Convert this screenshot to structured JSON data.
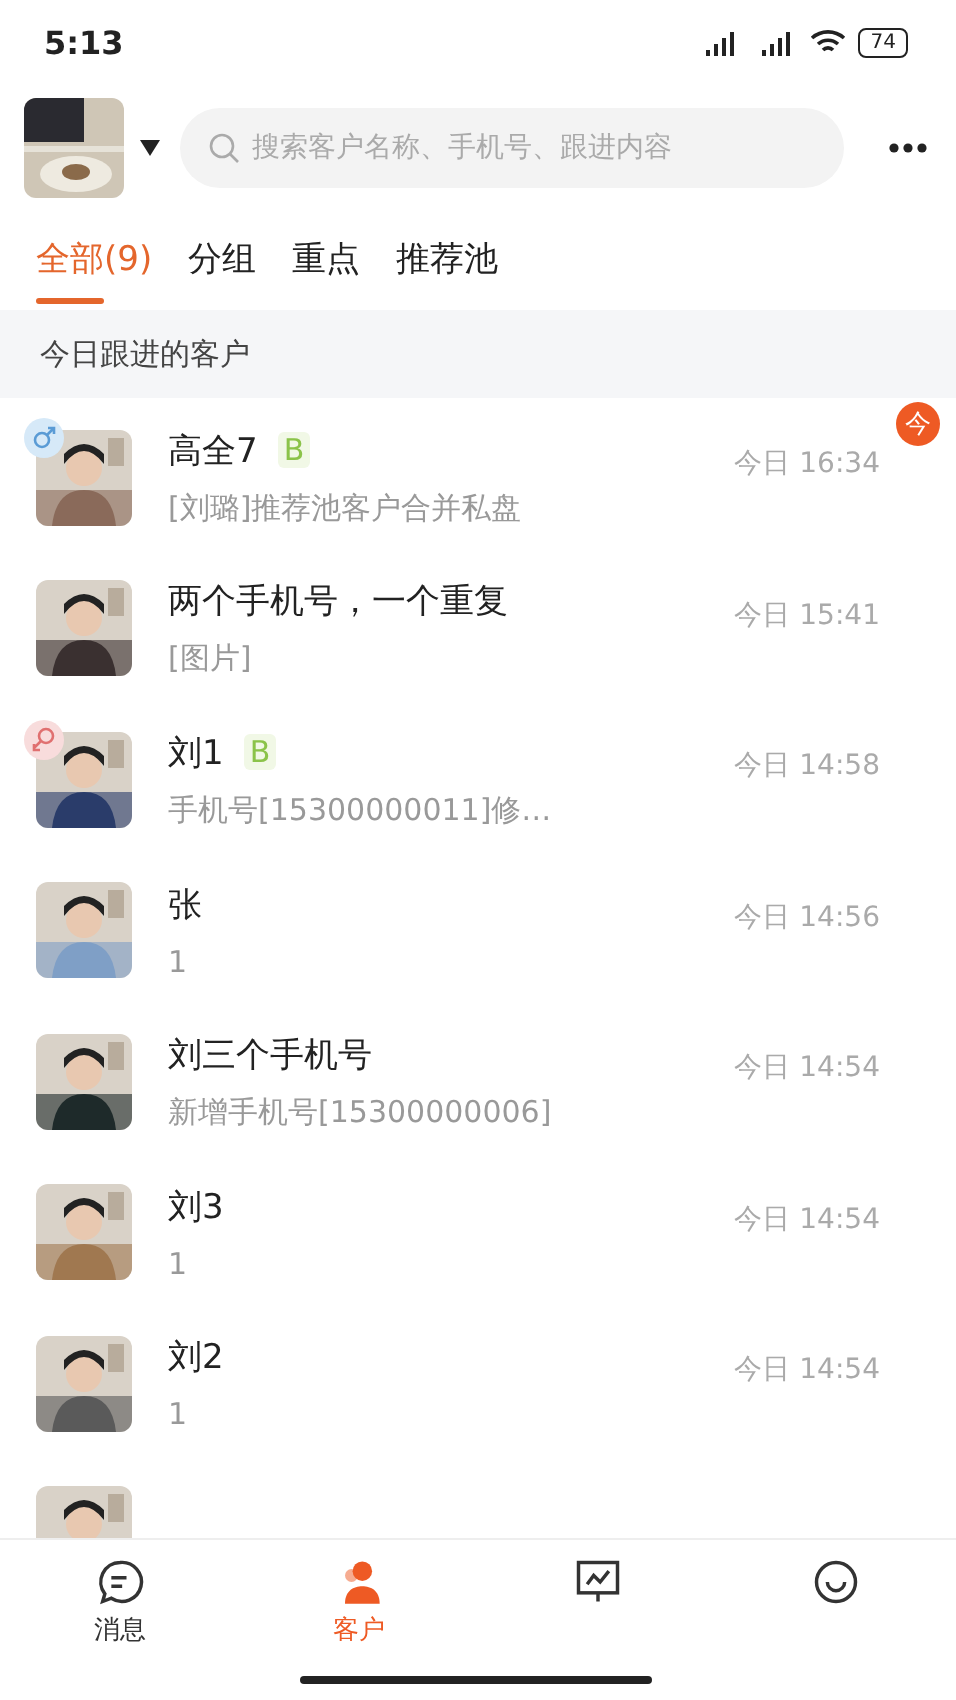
{
  "status_bar": {
    "time": "5:13",
    "battery": "74"
  },
  "header": {
    "search": {
      "placeholder": "搜索客户名称、手机号、跟进内容"
    }
  },
  "tabs": [
    {
      "label": "全部(9)",
      "selected": true
    },
    {
      "label": "分组",
      "selected": false
    },
    {
      "label": "重点",
      "selected": false
    },
    {
      "label": "推荐池",
      "selected": false
    }
  ],
  "section_title": "今日跟进的客户",
  "customers": [
    {
      "name": "高全7",
      "tag": "B",
      "preview": "[刘璐]推荐池客户合并私盘",
      "time": "今日 16:34",
      "kind": "male",
      "badge": "今"
    },
    {
      "name": "两个手机号，一个重复",
      "preview": "[图片]",
      "time": "今日 15:41"
    },
    {
      "name": "刘1",
      "tag": "B",
      "preview": "手机号[15300000011]修…",
      "time": "今日 14:58",
      "kind": "female"
    },
    {
      "name": "张",
      "preview": "1",
      "time": "今日 14:56"
    },
    {
      "name": "刘三个手机号",
      "preview": "新增手机号[15300000006]",
      "time": "今日 14:54"
    },
    {
      "name": "刘3",
      "preview": "1",
      "time": "今日 14:54"
    },
    {
      "name": "刘2",
      "preview": "1",
      "time": "今日 14:54"
    },
    {
      "kind": "picture"
    }
  ],
  "bottom_nav": [
    {
      "label": "消息",
      "selected": false
    },
    {
      "label": "客户",
      "selected": true
    },
    {
      "selected": false
    },
    {
      "selected": false
    }
  ]
}
